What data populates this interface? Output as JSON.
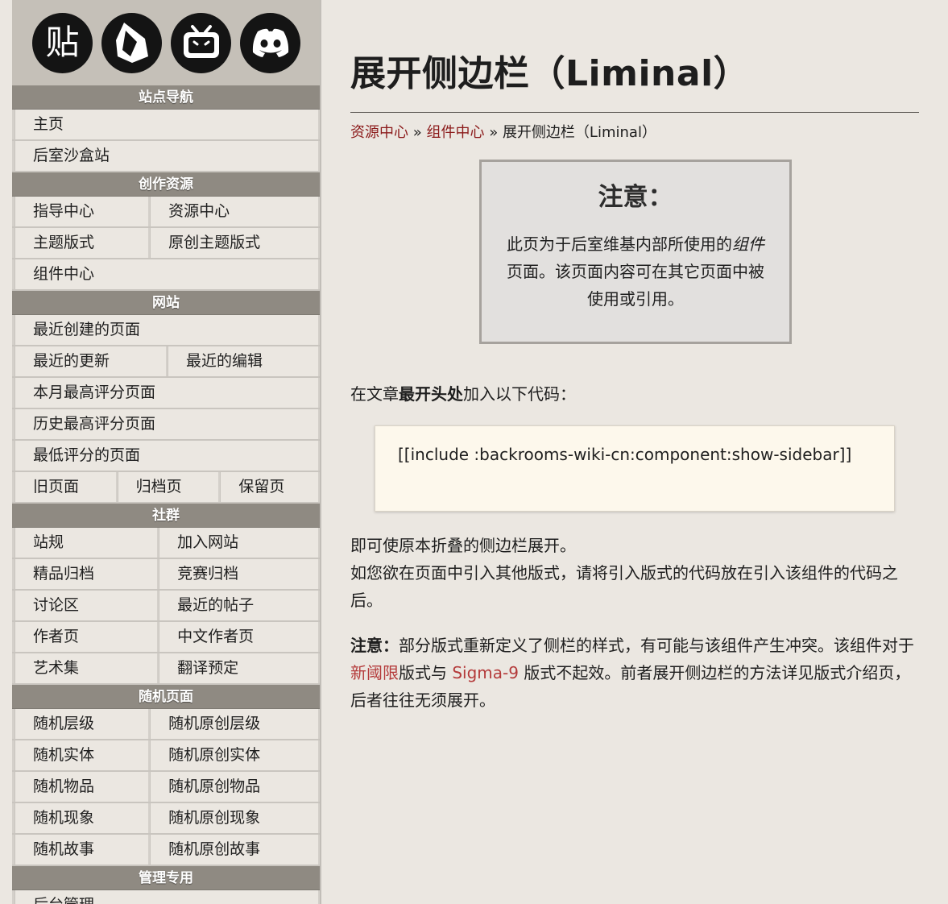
{
  "sidebar": {
    "icons": [
      {
        "name": "tieba-icon",
        "glyph": "贴"
      },
      {
        "name": "flame-logo-icon",
        "glyph": ""
      },
      {
        "name": "bilibili-icon",
        "glyph": ""
      },
      {
        "name": "discord-icon",
        "glyph": ""
      }
    ],
    "sections": [
      {
        "title": "站点导航",
        "rows": [
          [
            "主页"
          ],
          [
            "后室沙盒站"
          ]
        ]
      },
      {
        "title": "创作资源",
        "rows": [
          [
            "指导中心",
            "资源中心"
          ],
          [
            "主题版式",
            "原创主题版式"
          ],
          [
            "组件中心"
          ]
        ]
      },
      {
        "title": "网站",
        "rows": [
          [
            "最近创建的页面"
          ],
          [
            "最近的更新",
            "最近的编辑"
          ],
          [
            "本月最高评分页面"
          ],
          [
            "历史最高评分页面"
          ],
          [
            "最低评分的页面"
          ],
          [
            "旧页面",
            "归档页",
            "保留页"
          ]
        ]
      },
      {
        "title": "社群",
        "rows": [
          [
            "站规",
            "加入网站"
          ],
          [
            "精品归档",
            "竞赛归档"
          ],
          [
            "讨论区",
            "最近的帖子"
          ],
          [
            "作者页",
            "中文作者页"
          ],
          [
            "艺术集",
            "翻译预定"
          ]
        ]
      },
      {
        "title": "随机页面",
        "rows": [
          [
            "随机层级",
            "随机原创层级"
          ],
          [
            "随机实体",
            "随机原创实体"
          ],
          [
            "随机物品",
            "随机原创物品"
          ],
          [
            "随机现象",
            "随机原创现象"
          ],
          [
            "随机故事",
            "随机原创故事"
          ]
        ]
      },
      {
        "title": "管理专用",
        "rows": [
          [
            "后台管理"
          ]
        ]
      }
    ]
  },
  "main": {
    "title": "展开侧边栏（Liminal）",
    "breadcrumb": {
      "link1": "资源中心",
      "sep1": " » ",
      "link2": "组件中心",
      "sep2": " » ",
      "current": "展开侧边栏（Liminal）"
    },
    "notice": {
      "title": "注意：",
      "text_pre": "此页为于后室维基内部所使用的",
      "text_em": "组件",
      "text_post": "页面。该页面内容可在其它页面中被使用或引用。"
    },
    "instruction": {
      "pre": "在文章",
      "bold": "最开头处",
      "post": "加入以下代码："
    },
    "code": "[[include :backrooms-wiki-cn:component:show-sidebar]]",
    "result_line1": "即可使原本折叠的侧边栏展开。",
    "result_line2": "如您欲在页面中引入其他版式，请将引入版式的代码放在引入该组件的代码之后。",
    "note": {
      "bold": "注意：",
      "text1": "部分版式重新定义了侧栏的样式，有可能与该组件产生冲突。该组件对于",
      "link1": "新阈限",
      "text2": "版式与 ",
      "link2": "Sigma-9",
      "text3": " 版式不起效。前者展开侧边栏的方法详见版式介绍页，后者往往无须展开。"
    }
  }
}
